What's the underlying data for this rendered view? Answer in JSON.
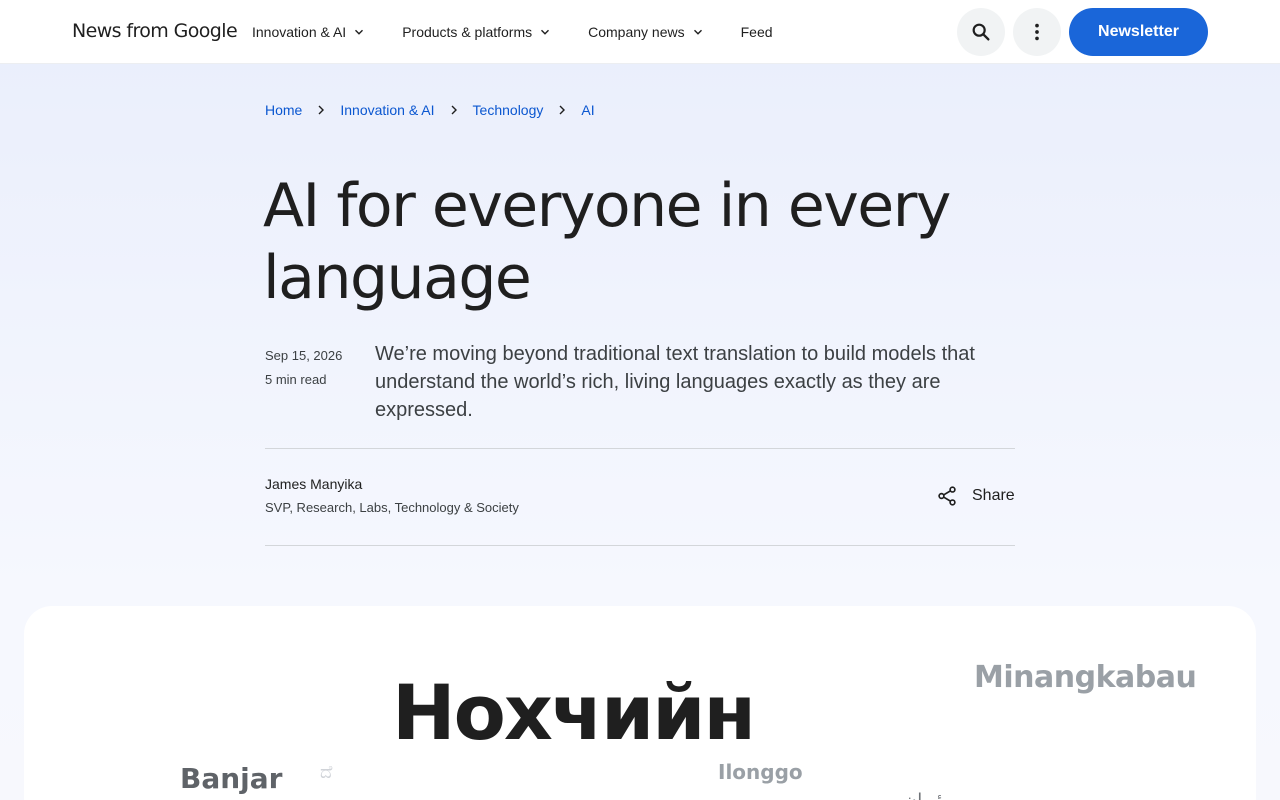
{
  "header": {
    "logo": "News from Google",
    "nav": [
      {
        "label": "Innovation & AI",
        "has_menu": true
      },
      {
        "label": "Products & platforms",
        "has_menu": true
      },
      {
        "label": "Company news",
        "has_menu": true
      },
      {
        "label": "Feed",
        "has_menu": false
      }
    ],
    "icons": [
      "search-icon",
      "more-vert-icon"
    ],
    "newsletter_label": "Newsletter"
  },
  "breadcrumb": [
    "Home",
    "Innovation & AI",
    "Technology",
    "AI"
  ],
  "article": {
    "title": "AI for everyone in every language",
    "date": "Sep 15, 2026",
    "read_time": "5 min read",
    "summary": "We’re moving beyond traditional text translation to build models that understand the world’s rich, living languages exactly as they are expressed.",
    "author_name": "James Manyika",
    "author_role": "SVP, Research, Labs, Technology & Society",
    "share_label": "Share"
  },
  "hero": {
    "words": {
      "big": "Нохчийн",
      "minangkabau": "Minangkabau",
      "banjar": "Banjar",
      "ilonggo": "Ilonggo",
      "faint1": "ದೆ",
      "faint2": "ئیوان"
    }
  },
  "colors": {
    "accent": "#1a66d9",
    "link": "#0b57d0",
    "text": "#1f1f1f",
    "muted": "#3c4043"
  }
}
